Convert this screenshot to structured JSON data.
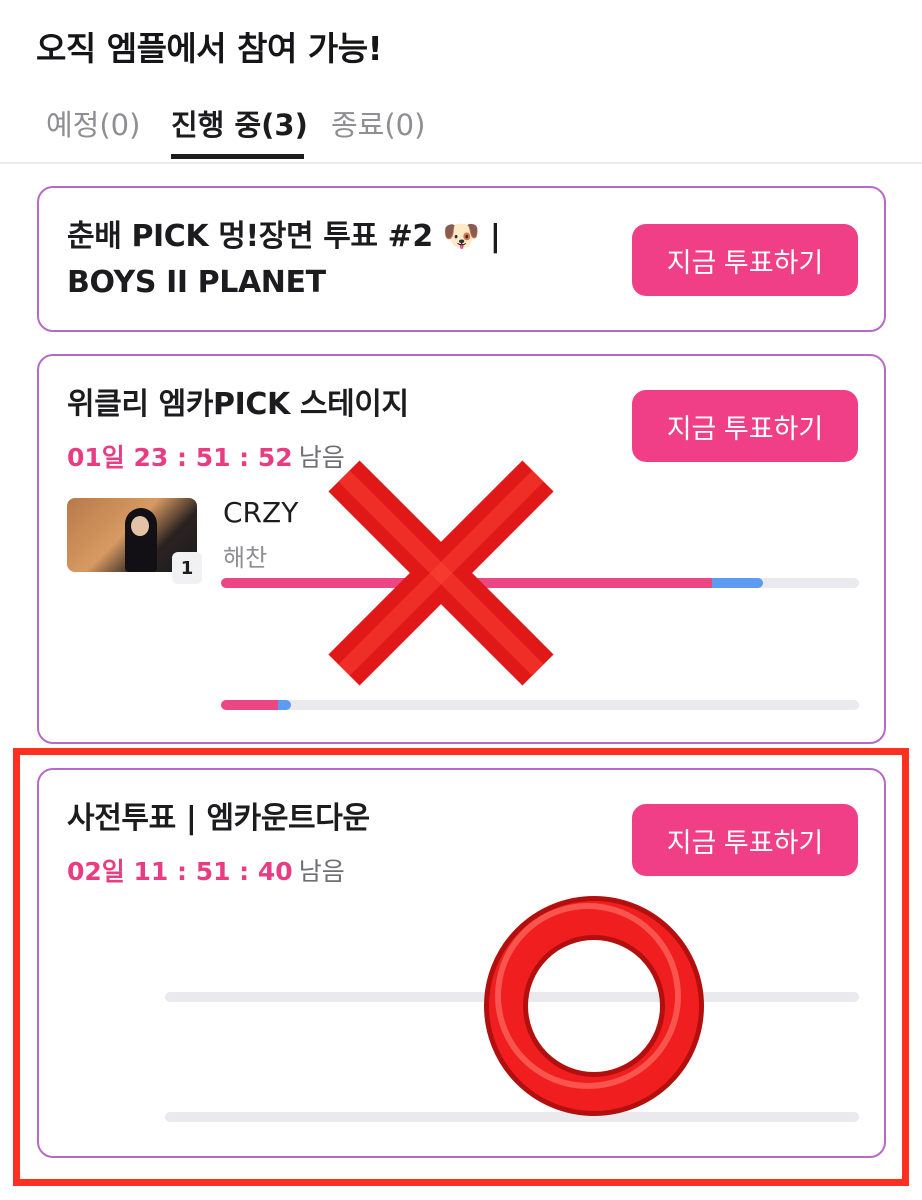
{
  "header": {
    "title": "오직 엠플에서 참여 가능!"
  },
  "tabs": [
    {
      "label": "예정(0)",
      "active": false
    },
    {
      "label": "진행 중(3)",
      "active": true
    },
    {
      "label": "종료(0)",
      "active": false
    }
  ],
  "cards": [
    {
      "title_line1": "춘배 PICK 멍!장면 투표 #2 🐶 |",
      "title_line2": "BOYS II PLANET",
      "button_label": "지금 투표하기"
    },
    {
      "title": "위클리 엠카PICK 스테이지",
      "timer": "01일 23 : 51 : 52",
      "remaining_label": "남음",
      "button_label": "지금 투표하기",
      "entries": [
        {
          "rank": "1",
          "song": "CRZY",
          "artist": "해찬",
          "pink_fraction": 0.77,
          "blue_fraction": 0.08
        },
        {
          "pink_fraction": 0.09,
          "blue_fraction": 0.02
        }
      ]
    },
    {
      "title": "사전투표 | 엠카운트다운",
      "timer": "02일 11 : 51 : 40",
      "remaining_label": "남음",
      "button_label": "지금 투표하기",
      "entries": [
        {
          "pink_fraction": 0,
          "blue_fraction": 0
        },
        {
          "pink_fraction": 0,
          "blue_fraction": 0
        }
      ]
    }
  ],
  "overlays": {
    "cross_icon": "red-x-mark",
    "circle_icon": "red-o-mark",
    "highlight_color": "#ff3020"
  },
  "colors": {
    "accent_pink": "#f03f86",
    "bar_pink": "#ec4784",
    "bar_blue": "#5c9bf0",
    "card_border": "#b76ac6"
  }
}
